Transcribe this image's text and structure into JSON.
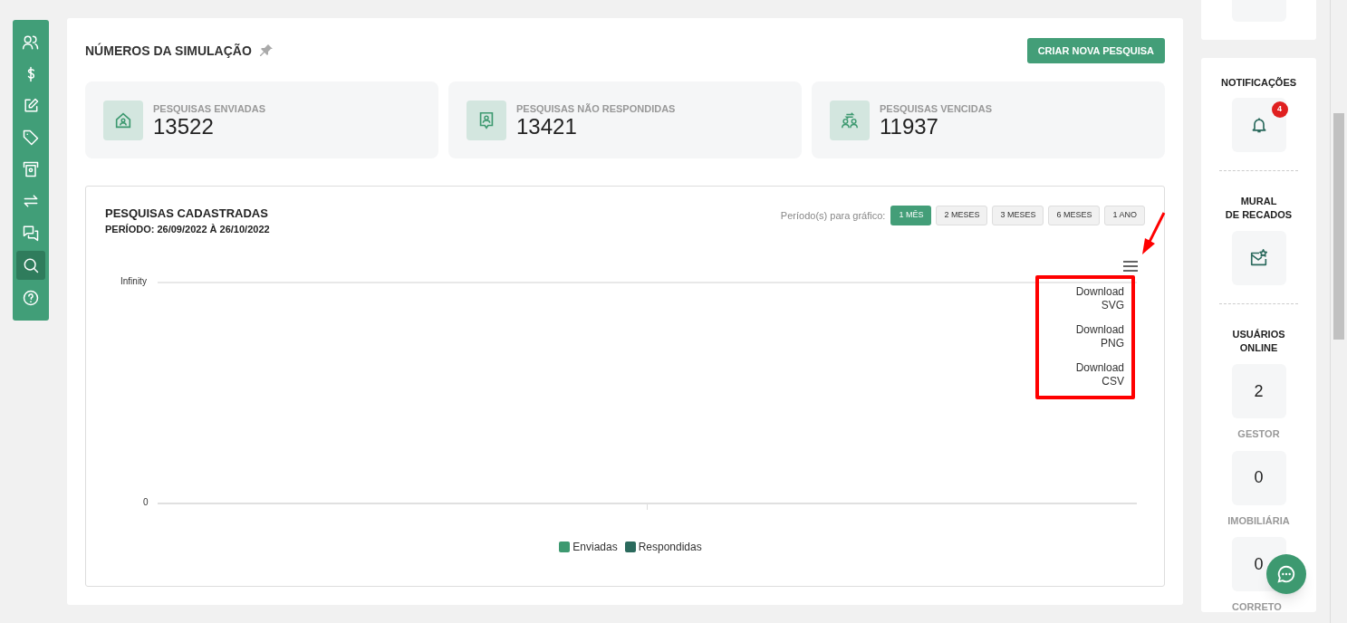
{
  "sidebar": {
    "items": [
      {
        "selected": false
      },
      {
        "selected": false
      },
      {
        "selected": false
      },
      {
        "selected": false
      },
      {
        "selected": false
      },
      {
        "selected": false
      },
      {
        "selected": false
      },
      {
        "selected": true
      },
      {
        "selected": false
      }
    ]
  },
  "header": {
    "title": "NÚMEROS DA SIMULAÇÃO",
    "button": "CRIAR NOVA PESQUISA"
  },
  "stats": [
    {
      "label": "PESQUISAS ENVIADAS",
      "value": "13522"
    },
    {
      "label": "PESQUISAS NÃO RESPONDIDAS",
      "value": "13421"
    },
    {
      "label": "PESQUISAS VENCIDAS",
      "value": "11937"
    }
  ],
  "chart_card": {
    "title": "PESQUISAS CADASTRADAS",
    "period": "PERÍODO: 26/09/2022 À 26/10/2022",
    "period_label": "Período(s) para gráfico:",
    "periods": [
      {
        "label": "1 MÊS",
        "selected": true
      },
      {
        "label": "2 MESES",
        "selected": false
      },
      {
        "label": "3 MESES",
        "selected": false
      },
      {
        "label": "6 MESES",
        "selected": false
      },
      {
        "label": "1 ANO",
        "selected": false
      }
    ],
    "y_labels": [
      "Infinity",
      "0"
    ],
    "menu": [
      "Download\nSVG",
      "Download\nPNG",
      "Download\nCSV"
    ],
    "legend": [
      {
        "name": "Enviadas",
        "color": "#3d9970"
      },
      {
        "name": "Respondidas",
        "color": "#2b6a5d"
      }
    ]
  },
  "right_panel": {
    "notifications": {
      "title": "NOTIFICAÇÕES",
      "badge": "4"
    },
    "mural": {
      "title": "MURAL\nDE RECADOS"
    },
    "online": {
      "title": "USUÁRIOS\nONLINE",
      "groups": [
        {
          "count": "2",
          "label": "GESTOR"
        },
        {
          "count": "0",
          "label": "IMOBILIÁRIA"
        },
        {
          "count": "0",
          "label": "CORRETO"
        }
      ]
    }
  }
}
